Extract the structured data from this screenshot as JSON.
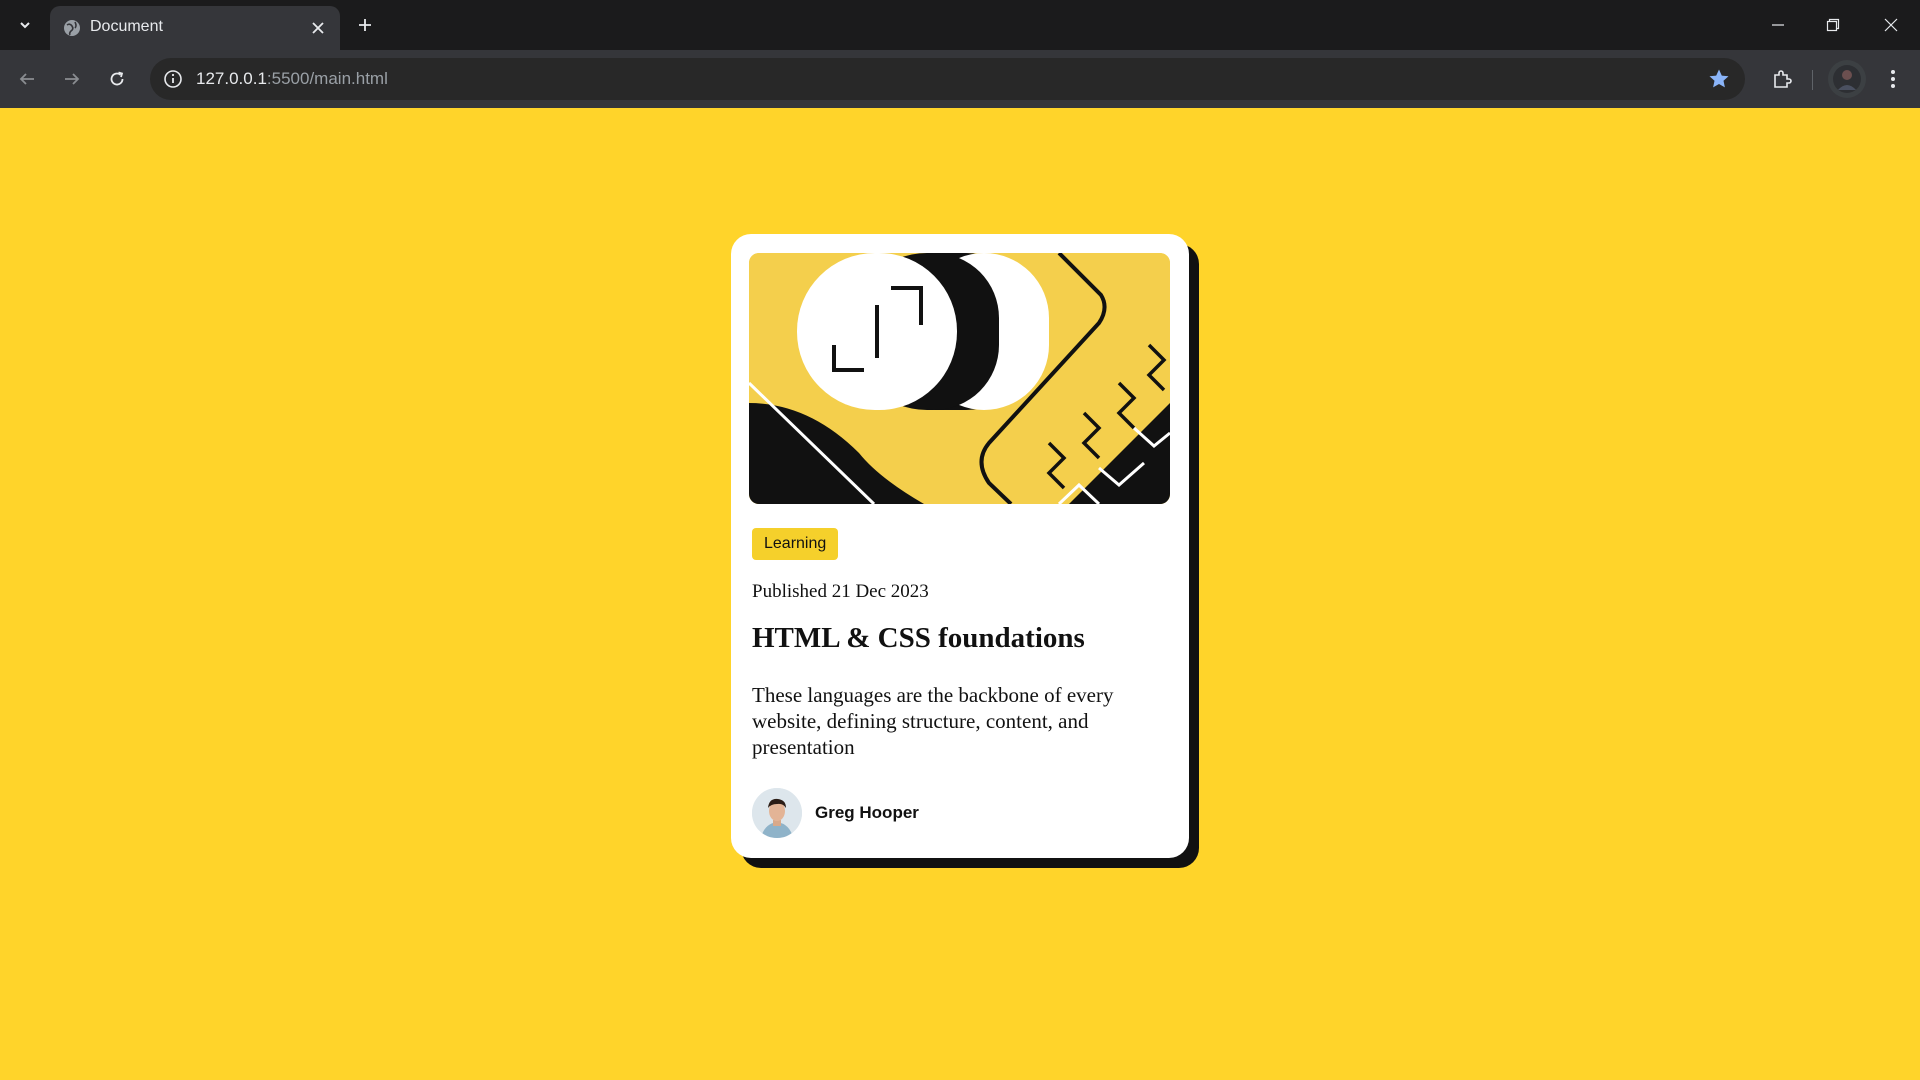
{
  "browser": {
    "tab": {
      "title": "Document"
    },
    "address": {
      "host": "127.0.0.1",
      "rest": ":5500/main.html"
    }
  },
  "card": {
    "tag": "Learning",
    "published": "Published 21 Dec 2023",
    "title": "HTML & CSS foundations",
    "description": "These languages are the backbone of every website, defining structure, content, and presentation",
    "author": {
      "name": "Greg Hooper"
    }
  },
  "colors": {
    "page_background": "#ffd42a",
    "card_background": "#ffffff",
    "tag_background": "#f5d02b",
    "shadow": "#111111"
  }
}
